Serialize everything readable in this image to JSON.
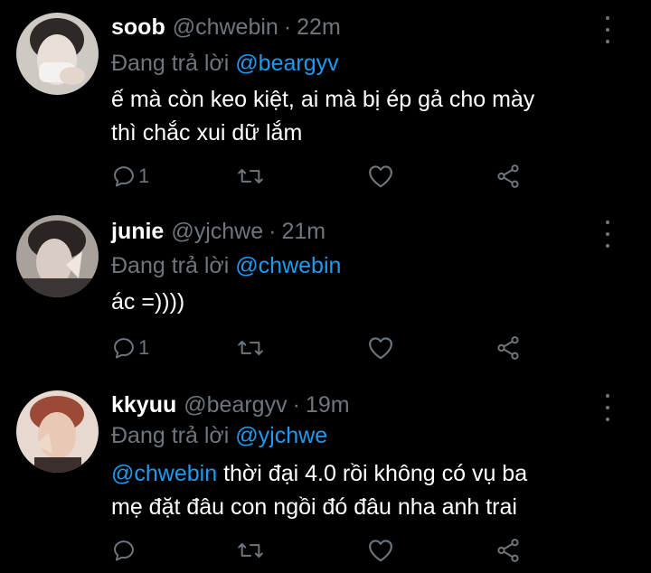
{
  "tweets": [
    {
      "name": "soob",
      "handle": "@chwebin",
      "dot": "·",
      "time": "22m",
      "replying_prefix": "Đang trả lời",
      "replying_to": "@beargyv",
      "body_lines": [
        "ế mà còn keo kiệt, ai mà bị ép gả cho mày",
        "thì chắc xui dữ lắm"
      ],
      "reply_count": "1",
      "avatar_colors": [
        "#d9d4cf",
        "#3a3330"
      ]
    },
    {
      "name": "junie",
      "handle": "@yjchwe",
      "dot": "·",
      "time": "21m",
      "replying_prefix": "Đang trả lời",
      "replying_to": "@chwebin",
      "body_lines": [
        "ác =))))"
      ],
      "reply_count": "1",
      "avatar_colors": [
        "#b8b0aa",
        "#2b2624"
      ]
    },
    {
      "name": "kkyuu",
      "handle": "@beargyv",
      "dot": "·",
      "time": "19m",
      "replying_prefix": "Đang trả lời",
      "replying_to": "@yjchwe",
      "body_mention": "@chwebin",
      "body_lines": [
        "thời đại 4.0 rồi không có vụ ba",
        "mẹ đặt đâu con ngồi đó đâu nha anh trai"
      ],
      "reply_count": "",
      "avatar_colors": [
        "#c9a08a",
        "#7a3b2c"
      ]
    }
  ],
  "colors": {
    "background": "#000000",
    "text": "#ffffff",
    "muted": "#6e767d",
    "link": "#1d9bf0"
  },
  "icons": [
    "reply-icon",
    "retweet-icon",
    "like-icon",
    "share-icon",
    "more-icon"
  ]
}
